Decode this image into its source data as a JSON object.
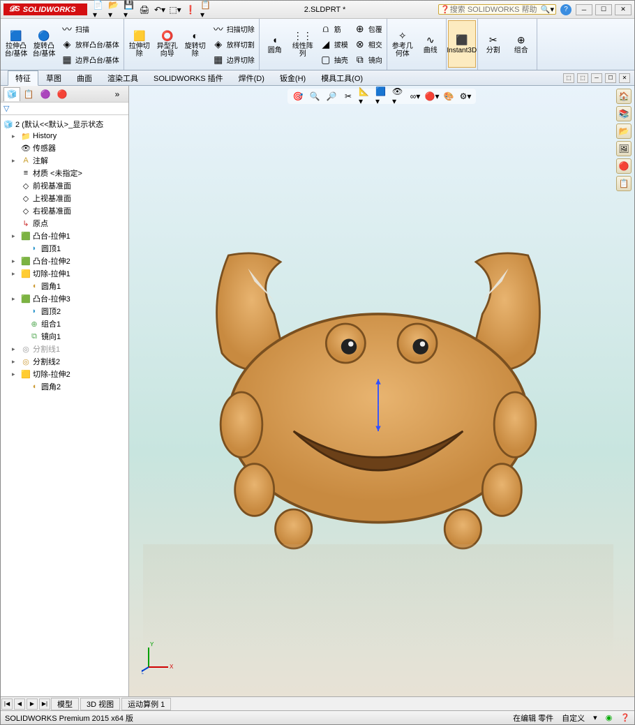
{
  "title": {
    "logo_text": "SOLIDWORKS",
    "filename": "2.SLDPRT *",
    "search_placeholder": "搜索 SOLIDWORKS 帮助"
  },
  "ribbon": {
    "g1": {
      "b1": "拉伸凸台/基体",
      "b2": "旋转凸台/基体",
      "r1": "扫描",
      "r2": "放样凸台/基体",
      "r3": "边界凸台/基体"
    },
    "g2": {
      "b1": "拉伸切除",
      "b2": "异型孔向导",
      "b3": "旋转切除",
      "r1": "扫描切除",
      "r2": "放样切割",
      "r3": "边界切除"
    },
    "g3": {
      "b1": "圆角",
      "b2": "线性阵列",
      "r1": "筋",
      "r2": "拔模",
      "r3": "抽壳",
      "r4": "包覆",
      "r5": "相交",
      "r6": "镜向"
    },
    "g4": {
      "b1": "参考几何体",
      "b2": "曲线"
    },
    "g5": {
      "b1": "Instant3D"
    },
    "g6": {
      "b1": "分割",
      "b2": "组合"
    }
  },
  "tabs": {
    "t1": "特征",
    "t2": "草图",
    "t3": "曲面",
    "t4": "渲染工具",
    "t5": "SOLIDWORKS 插件",
    "t6": "焊件(D)",
    "t7": "钣金(H)",
    "t8": "模具工具(O)"
  },
  "tree": {
    "root": "2  (默认<<默认>_显示状态",
    "items": [
      "History",
      "传感器",
      "注解",
      "材质 <未指定>",
      "前视基准面",
      "上视基准面",
      "右视基准面",
      "原点",
      "凸台-拉伸1",
      "圆顶1",
      "凸台-拉伸2",
      "切除-拉伸1",
      "圆角1",
      "凸台-拉伸3",
      "圆顶2",
      "组合1",
      "镜向1",
      "分割线1",
      "分割线2",
      "切除-拉伸2",
      "圆角2"
    ]
  },
  "bottom_tabs": {
    "t1": "模型",
    "t2": "3D 视图",
    "t3": "运动算例 1"
  },
  "status": {
    "left": "SOLIDWORKS Premium 2015 x64 版",
    "mid": "在编辑 零件",
    "right": "自定义"
  }
}
